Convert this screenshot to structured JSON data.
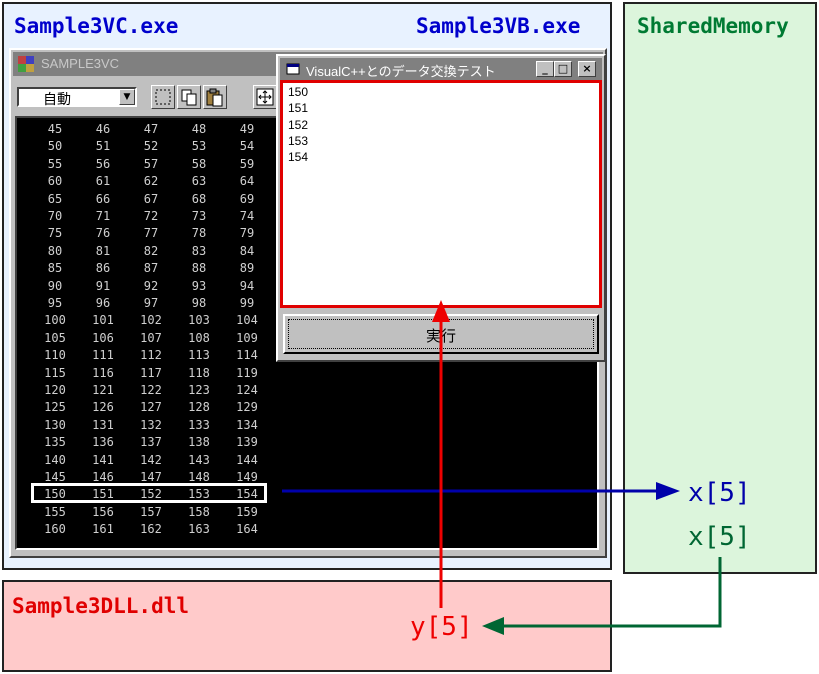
{
  "regions": {
    "vc_exe": "Sample3VC.exe",
    "vb_exe": "Sample3VB.exe",
    "shared_memory": "SharedMemory",
    "dll": "Sample3DLL.dll"
  },
  "vc_window": {
    "title": "SAMPLE3VC",
    "combo_value": "自動",
    "icons": [
      "select-rect-icon",
      "copy-icon",
      "paste-icon",
      "fit-icon"
    ],
    "rows": [
      [
        45,
        46,
        47,
        48,
        49
      ],
      [
        50,
        51,
        52,
        53,
        54
      ],
      [
        55,
        56,
        57,
        58,
        59
      ],
      [
        60,
        61,
        62,
        63,
        64
      ],
      [
        65,
        66,
        67,
        68,
        69
      ],
      [
        70,
        71,
        72,
        73,
        74
      ],
      [
        75,
        76,
        77,
        78,
        79
      ],
      [
        80,
        81,
        82,
        83,
        84
      ],
      [
        85,
        86,
        87,
        88,
        89
      ],
      [
        90,
        91,
        92,
        93,
        94
      ],
      [
        95,
        96,
        97,
        98,
        99
      ],
      [
        100,
        101,
        102,
        103,
        104
      ],
      [
        105,
        106,
        107,
        108,
        109
      ],
      [
        110,
        111,
        112,
        113,
        114
      ],
      [
        115,
        116,
        117,
        118,
        119
      ],
      [
        120,
        121,
        122,
        123,
        124
      ],
      [
        125,
        126,
        127,
        128,
        129
      ],
      [
        130,
        131,
        132,
        133,
        134
      ],
      [
        135,
        136,
        137,
        138,
        139
      ],
      [
        140,
        141,
        142,
        143,
        144
      ],
      [
        145,
        146,
        147,
        148,
        149
      ],
      [
        150,
        151,
        152,
        153,
        154
      ],
      [
        155,
        156,
        157,
        158,
        159
      ],
      [
        160,
        161,
        162,
        163,
        164
      ]
    ],
    "highlighted_row": 21
  },
  "vb_window": {
    "title": "VisualC++とのデータ交換テスト",
    "list_items": [
      "150",
      "151",
      "152",
      "153",
      "154"
    ],
    "execute_label": "実行",
    "minimize": "_",
    "maximize": "□",
    "close": "×"
  },
  "variables": {
    "shared_x_in": "x[5]",
    "shared_x_out": "x[5]",
    "dll_y": "y[5]"
  },
  "colors": {
    "vc_title": "#0000cc",
    "shared_title": "#007a33",
    "dll_title": "#e00000",
    "blue_arrow": "#0000aa",
    "green_arrow": "#006633",
    "red_arrow": "#ee0000",
    "vc_bg": "#e8f2ff",
    "shared_bg": "#dcf5dc",
    "dll_bg": "#ffcaca"
  }
}
